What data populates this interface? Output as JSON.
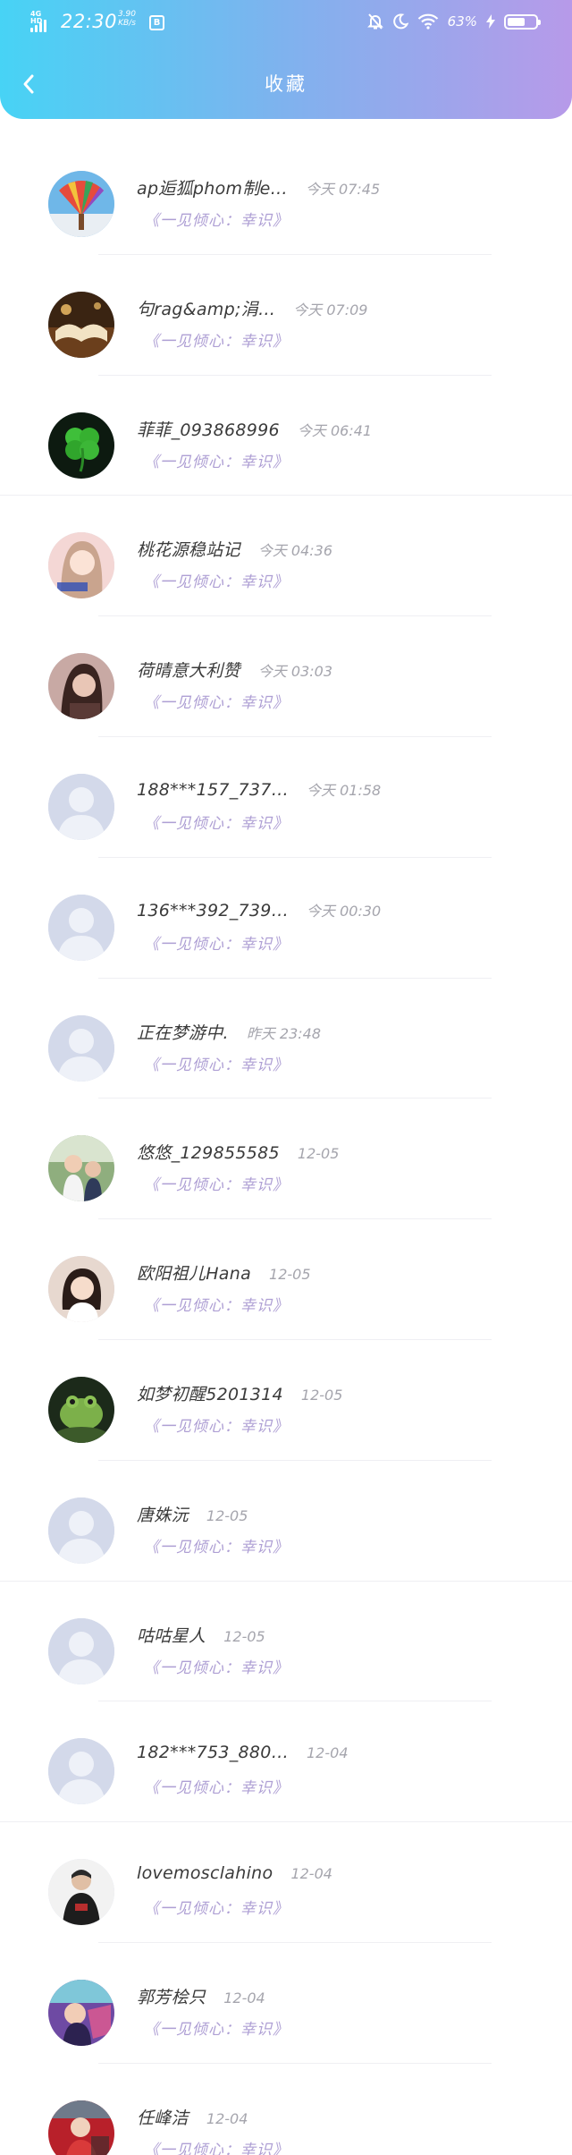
{
  "status_bar": {
    "network": "4G HD",
    "time": "22:30",
    "speed_value": "3.90",
    "speed_unit": "KB/s",
    "app_icon_glyph": "B",
    "battery_percent": "63%",
    "battery_level": 0.63,
    "icons": [
      "signal-icon",
      "mute-bell-icon",
      "moon-icon",
      "wifi-icon",
      "charging-icon",
      "battery-icon"
    ]
  },
  "header": {
    "title": "收藏",
    "back_icon": "chevron-left-icon",
    "gradient": [
      "#47d3f5",
      "#7fb2ee",
      "#b79ae9"
    ]
  },
  "colors": {
    "name": "#3a3a3a",
    "time": "#a5a5ad",
    "subtitle": "#ae9fd4",
    "default_avatar": "#d3d9ea"
  },
  "favorites": [
    {
      "name": "ap逅狐phom制e…",
      "time": "今天 07:45",
      "subtitle": "《一见倾心：幸识》",
      "avatar": "fan-photo"
    },
    {
      "name": "句rag&amp;涓…",
      "time": "今天 07:09",
      "subtitle": "《一见倾心：幸识》",
      "avatar": "book-photo"
    },
    {
      "name": "菲菲_093868996",
      "time": "今天 06:41",
      "subtitle": "《一见倾心：幸识》",
      "avatar": "clover-photo"
    },
    {
      "name": "桃花源稳站记",
      "time": "今天 04:36",
      "subtitle": "《一见倾心：幸识》",
      "avatar": "girl-photo"
    },
    {
      "name": "荷晴意大利赞",
      "time": "今天 03:03",
      "subtitle": "《一见倾心：幸识》",
      "avatar": "portrait-photo"
    },
    {
      "name": "188***157_737…",
      "time": "今天 01:58",
      "subtitle": "《一见倾心：幸识》",
      "avatar": "default"
    },
    {
      "name": "136***392_739…",
      "time": "今天 00:30",
      "subtitle": "《一见倾心：幸识》",
      "avatar": "default"
    },
    {
      "name": "正在梦游中.",
      "time": "昨天 23:48",
      "subtitle": "《一见倾心：幸识》",
      "avatar": "default"
    },
    {
      "name": "悠悠_129855585",
      "time": "12-05",
      "subtitle": "《一见倾心：幸识》",
      "avatar": "kids-photo"
    },
    {
      "name": "欧阳祖儿Hana",
      "time": "12-05",
      "subtitle": "《一见倾心：幸识》",
      "avatar": "child-photo"
    },
    {
      "name": "如梦初醒5201314",
      "time": "12-05",
      "subtitle": "《一见倾心：幸识》",
      "avatar": "frog-photo"
    },
    {
      "name": "唐姝沅",
      "time": "12-05",
      "subtitle": "《一见倾心：幸识》",
      "avatar": "default"
    },
    {
      "name": "咕咕星人",
      "time": "12-05",
      "subtitle": "《一见倾心：幸识》",
      "avatar": "default"
    },
    {
      "name": "182***753_880…",
      "time": "12-04",
      "subtitle": "《一见倾心：幸识》",
      "avatar": "default"
    },
    {
      "name": "lovemosclahino",
      "time": "12-04",
      "subtitle": "《一见倾心：幸识》",
      "avatar": "man-photo"
    },
    {
      "name": "郭芳桧只",
      "time": "12-04",
      "subtitle": "《一见倾心：幸识》",
      "avatar": "purple-photo"
    },
    {
      "name": "任峰洁",
      "time": "12-04",
      "subtitle": "《一见倾心：幸识》",
      "avatar": "red-photo"
    }
  ]
}
